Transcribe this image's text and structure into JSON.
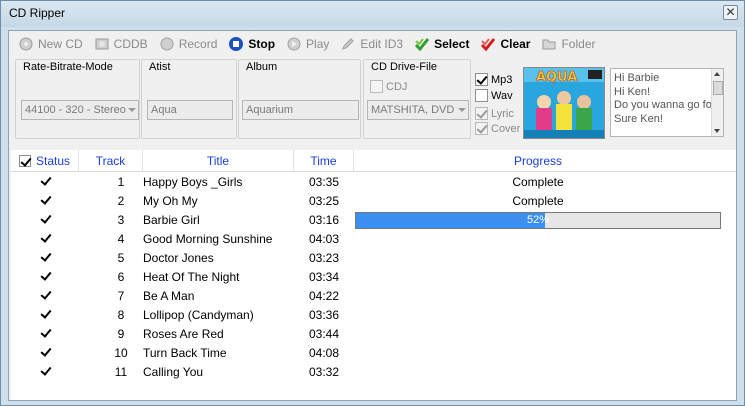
{
  "window": {
    "title": "CD Ripper"
  },
  "toolbar": {
    "buttons": [
      {
        "label": "New CD",
        "enabled": false,
        "icon": "new-cd-icon"
      },
      {
        "label": "CDDB",
        "enabled": false,
        "icon": "cddb-icon"
      },
      {
        "label": "Record",
        "enabled": false,
        "icon": "record-icon"
      },
      {
        "label": "Stop",
        "enabled": true,
        "icon": "stop-icon"
      },
      {
        "label": "Play",
        "enabled": false,
        "icon": "play-icon"
      },
      {
        "label": "Edit ID3",
        "enabled": false,
        "icon": "pencil-icon"
      },
      {
        "label": "Select",
        "enabled": true,
        "icon": "select-check-icon"
      },
      {
        "label": "Clear",
        "enabled": true,
        "icon": "clear-check-icon"
      },
      {
        "label": "Folder",
        "enabled": false,
        "icon": "folder-icon"
      }
    ]
  },
  "settings": {
    "rate_group_label": "Rate-Bitrate-Mode",
    "rate_value": "44100 - 320 - Stereo",
    "artist_group_label": "Atist",
    "artist_value": "Aqua",
    "album_group_label": "Album",
    "album_value": "Aquarium",
    "drive_group_label": "CD Drive-File",
    "cdj_label": "CDJ",
    "drive_value": "MATSHITA, DVD"
  },
  "options": {
    "mp3_label": "Mp3",
    "mp3_checked": true,
    "wav_label": "Wav",
    "wav_checked": false,
    "lyric_label": "Lyric",
    "lyric_checked": true,
    "cover_label": "Cover",
    "cover_checked": true
  },
  "lyrics": [
    "Hi Barbie",
    "Hi Ken!",
    "Do you wanna go for a ride?",
    "Sure Ken!"
  ],
  "columns": {
    "status": "Status",
    "track": "Track",
    "title": "Title",
    "time": "Time",
    "progress": "Progress"
  },
  "colors": {
    "accent": "#1a3fd6",
    "progress_fill": "#3b8ff0"
  },
  "tracks": [
    {
      "checked": true,
      "track": "1",
      "title": "Happy Boys _Girls",
      "time": "03:35",
      "progress": "Complete"
    },
    {
      "checked": true,
      "track": "2",
      "title": "My Oh My",
      "time": "03:25",
      "progress": "Complete"
    },
    {
      "checked": true,
      "track": "3",
      "title": "Barbie Girl",
      "time": "03:16",
      "progress": "52%",
      "progress_value": 0.52
    },
    {
      "checked": true,
      "track": "4",
      "title": "Good Morning Sunshine",
      "time": "04:03",
      "progress": ""
    },
    {
      "checked": true,
      "track": "5",
      "title": "Doctor Jones",
      "time": "03:23",
      "progress": ""
    },
    {
      "checked": true,
      "track": "6",
      "title": "Heat Of The Night",
      "time": "03:34",
      "progress": ""
    },
    {
      "checked": true,
      "track": "7",
      "title": "Be A Man",
      "time": "04:22",
      "progress": ""
    },
    {
      "checked": true,
      "track": "8",
      "title": "Lollipop (Candyman)",
      "time": "03:36",
      "progress": ""
    },
    {
      "checked": true,
      "track": "9",
      "title": "Roses Are Red",
      "time": "03:44",
      "progress": ""
    },
    {
      "checked": true,
      "track": "10",
      "title": "Turn Back Time",
      "time": "04:08",
      "progress": ""
    },
    {
      "checked": true,
      "track": "11",
      "title": "Calling You",
      "time": "03:32",
      "progress": ""
    }
  ]
}
